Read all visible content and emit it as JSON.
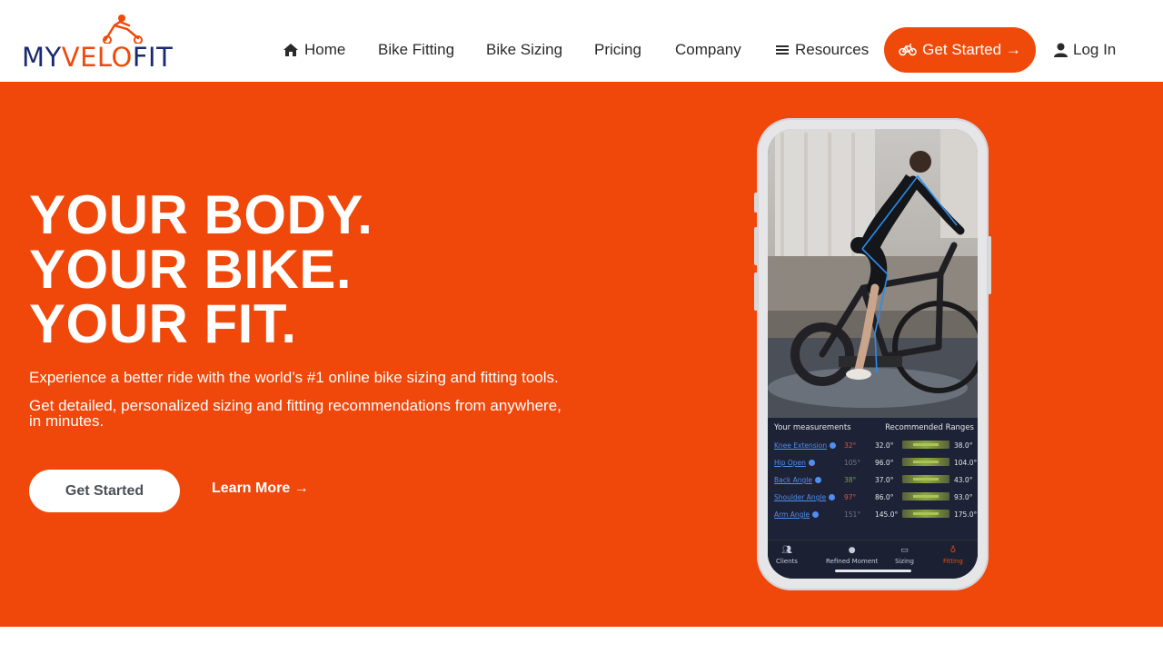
{
  "logo": {
    "my": "MY",
    "velo": "VELO",
    "fit": "FIT"
  },
  "nav": {
    "items": [
      {
        "label": "Home",
        "icon": "home-icon"
      },
      {
        "label": "Bike Fitting"
      },
      {
        "label": "Bike Sizing"
      },
      {
        "label": "Pricing"
      },
      {
        "label": "Company"
      },
      {
        "label": "Resources",
        "icon": "menu-icon"
      }
    ],
    "cta_label": "Get Started →",
    "cta_icon": "bicycle-icon",
    "login_label": "Log In",
    "login_icon": "user-icon"
  },
  "hero": {
    "headline": [
      "YOUR BODY.",
      "YOUR BIKE.",
      "YOUR FIT."
    ],
    "subtitle_1": "Experience a better ride with the world’s #1 online bike sizing and fitting tools.",
    "subtitle_2": "Get detailed, personalized sizing and fitting recommendations from anywhere, in minutes.",
    "primary_button": "Get Started",
    "secondary_link": "Learn More →"
  },
  "phone_app": {
    "panel_title": "Your measurements",
    "ranges_title": "Recommended Ranges",
    "measurements": [
      {
        "name": "Knee Extension",
        "value": "32°",
        "value_color": "#e0573a",
        "min": "32.0°",
        "max": "38.0°"
      },
      {
        "name": "Hip Open",
        "value": "105°",
        "value_color": "#6f7785",
        "min": "96.0°",
        "max": "104.0°"
      },
      {
        "name": "Back Angle",
        "value": "38°",
        "value_color": "#7aa04a",
        "min": "37.0°",
        "max": "43.0°"
      },
      {
        "name": "Shoulder Angle",
        "value": "97°",
        "value_color": "#e0573a",
        "min": "86.0°",
        "max": "93.0°"
      },
      {
        "name": "Arm Angle",
        "value": "151°",
        "value_color": "#6f7785",
        "min": "145.0°",
        "max": "175.0°"
      }
    ],
    "tabs": [
      {
        "label": "Clients",
        "icon": "users-icon"
      },
      {
        "label": "Refined Moment",
        "icon": "person-icon"
      },
      {
        "label": "Sizing",
        "icon": "ruler-icon"
      },
      {
        "label": "Fitting",
        "icon": "bicycle-icon",
        "active": true
      }
    ]
  },
  "colors": {
    "brand_orange": "#f04a0a",
    "brand_navy": "#1b2a6e",
    "hero_bg": "#f0470a",
    "app_dark": "#1d2236",
    "link_blue": "#4f8ff0"
  }
}
